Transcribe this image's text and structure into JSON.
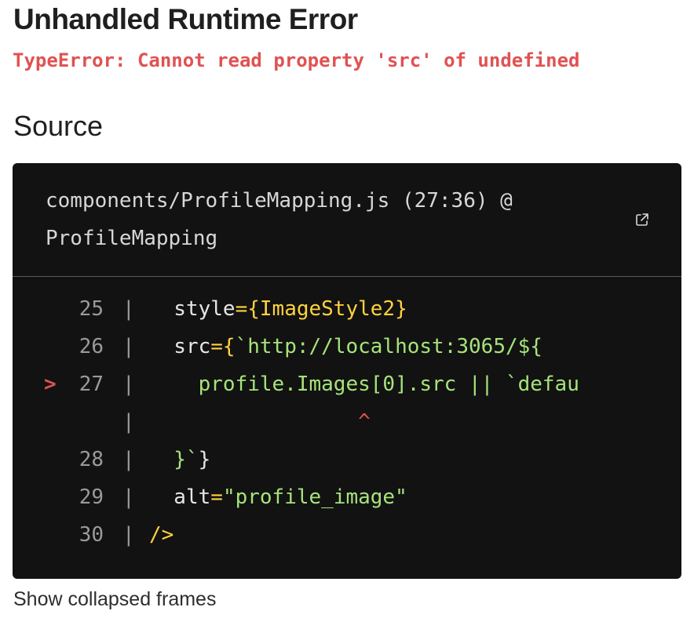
{
  "error": {
    "title": "Unhandled Runtime Error",
    "message": "TypeError: Cannot read property 'src' of undefined"
  },
  "source": {
    "heading": "Source",
    "location_line1": "components/ProfileMapping.js (27:36) @",
    "location_line2": "ProfileMapping",
    "open_icon": "external-link-icon",
    "highlight_marker": ">",
    "gutter_separator": "|",
    "caret": "^",
    "lines": [
      {
        "num": "25",
        "highlighted": false,
        "tokens": [
          {
            "t": "  style",
            "c": "attr"
          },
          {
            "t": "={",
            "c": "punct"
          },
          {
            "t": "ImageStyle2",
            "c": "ident"
          },
          {
            "t": "}",
            "c": "punct"
          }
        ]
      },
      {
        "num": "26",
        "highlighted": false,
        "tokens": [
          {
            "t": "  src",
            "c": "attr"
          },
          {
            "t": "={",
            "c": "punct"
          },
          {
            "t": "`http://localhost:3065/${",
            "c": "str"
          }
        ]
      },
      {
        "num": "27",
        "highlighted": true,
        "tokens": [
          {
            "t": "    profile.Images[0].src || `defau",
            "c": "str"
          }
        ]
      },
      {
        "num": "",
        "highlighted": false,
        "caret_col": "                 ^",
        "tokens": []
      },
      {
        "num": "28",
        "highlighted": false,
        "tokens": [
          {
            "t": "  }",
            "c": "str"
          },
          {
            "t": "`",
            "c": "str"
          },
          {
            "t": "}",
            "c": "plain"
          }
        ]
      },
      {
        "num": "29",
        "highlighted": false,
        "tokens": [
          {
            "t": "  alt",
            "c": "attr"
          },
          {
            "t": "=",
            "c": "punct"
          },
          {
            "t": "\"profile_image\"",
            "c": "str"
          }
        ]
      },
      {
        "num": "30",
        "highlighted": false,
        "tokens": [
          {
            "t": "/>",
            "c": "punct"
          }
        ]
      }
    ]
  },
  "footer": {
    "show_collapsed_label": "Show collapsed frames"
  },
  "colors": {
    "error_red": "#e05252",
    "code_bg": "#121212",
    "string_green": "#a6e37a",
    "punct_yellow": "#ffd23f"
  }
}
